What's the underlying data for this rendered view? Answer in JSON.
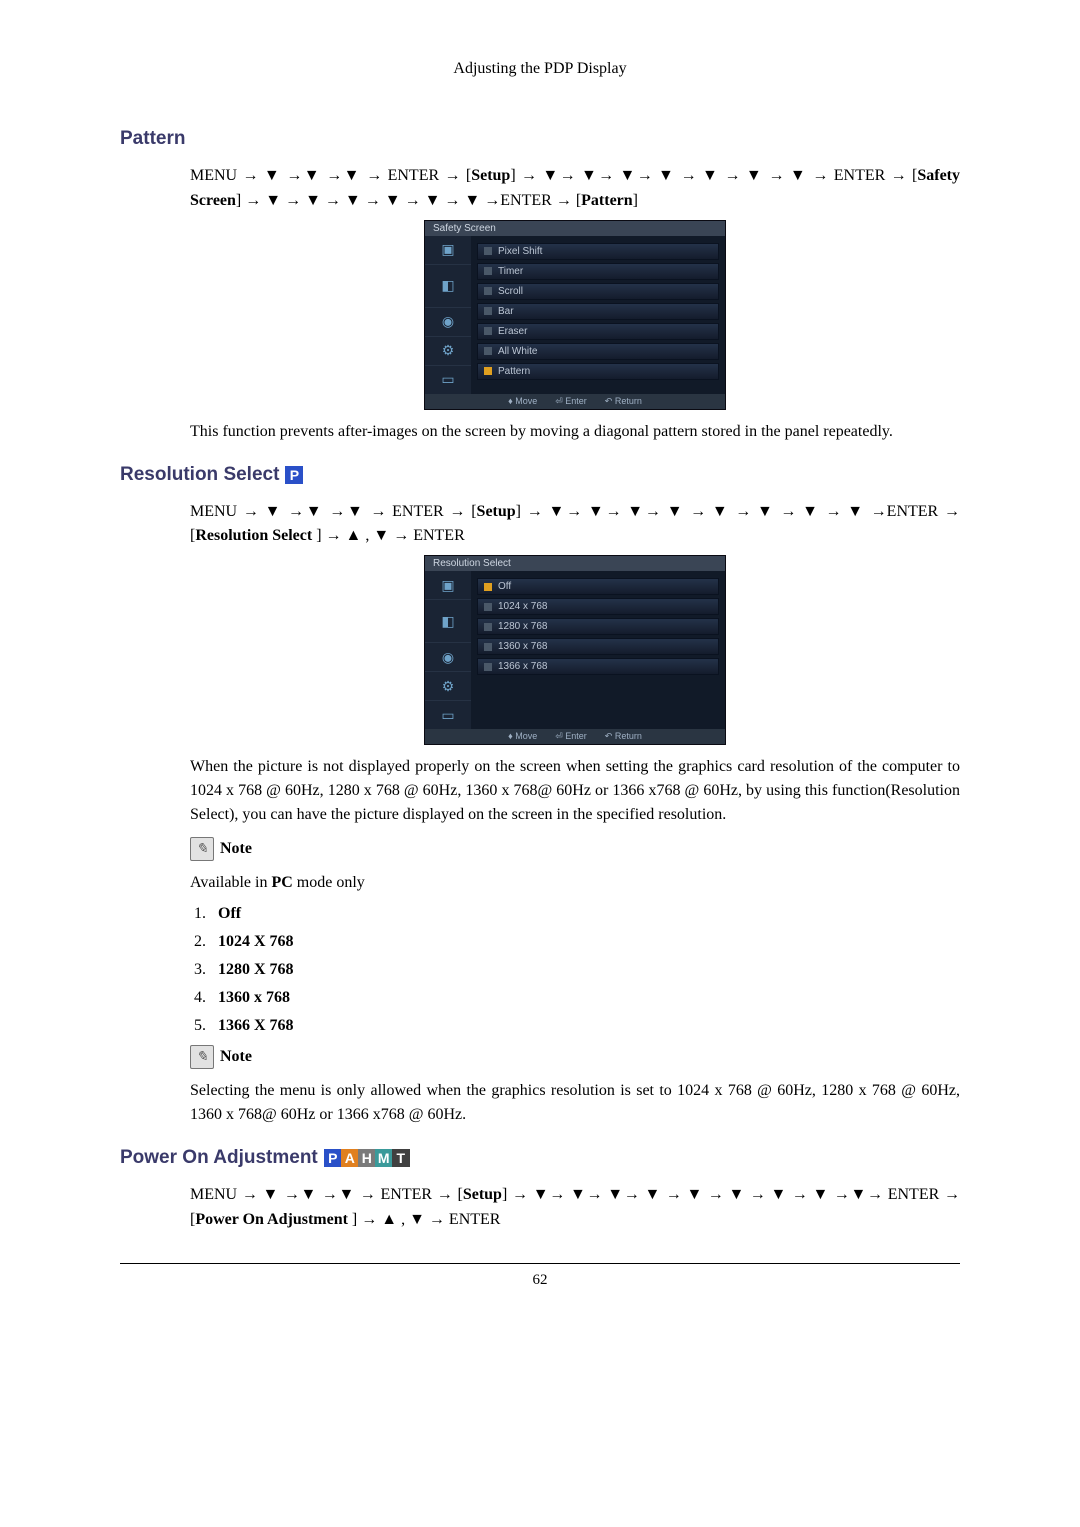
{
  "header": "Adjusting the PDP Display",
  "page_number": "62",
  "sections": {
    "pattern": {
      "title": "Pattern",
      "nav_path": "MENU → ▼ →▼ →▼ → ENTER → [Setup] → ▼→ ▼→ ▼→ ▼ → ▼ → ▼ → ▼ → ENTER → [Safety Screen] → ▼ → ▼ → ▼ → ▼ → ▼ → ▼ →ENTER → [Pattern]",
      "osd": {
        "title": "Safety Screen",
        "items": [
          "Pixel Shift",
          "Timer",
          "Scroll",
          "Bar",
          "Eraser",
          "All White",
          "Pattern"
        ],
        "active_index": 6,
        "footer": {
          "move": "Move",
          "enter": "Enter",
          "return": "Return"
        }
      },
      "description": "This function prevents after-images on the screen by moving a diagonal pattern stored in the panel repeatedly."
    },
    "resolution": {
      "title": "Resolution Select",
      "badges_p": "P",
      "nav_path": "MENU → ▼ →▼ →▼ → ENTER → [Setup] → ▼→ ▼→ ▼→ ▼ → ▼ → ▼ → ▼ → ▼ →ENTER → [Resolution Select ] → ▲ , ▼ → ENTER",
      "osd": {
        "title": "Resolution Select",
        "items": [
          "Off",
          "1024 x 768",
          "1280 x 768",
          "1360 x 768",
          "1366 x 768"
        ],
        "active_index": 0,
        "footer": {
          "move": "Move",
          "enter": "Enter",
          "return": "Return"
        }
      },
      "description": "When the picture is not displayed properly on the screen when setting the graphics card resolution of the computer to 1024 x 768 @ 60Hz, 1280 x 768 @ 60Hz, 1360 x 768@ 60Hz or 1366 x768 @ 60Hz, by using this function(Resolution Select), you can have the picture displayed on the screen in the specified resolution.",
      "note1_label": "Note",
      "note1_text_pre": "Available in ",
      "note1_text_bold": "PC",
      "note1_text_post": " mode only",
      "options": [
        "Off",
        "1024 X 768",
        "1280 X 768",
        "1360 x 768",
        "1366 X 768"
      ],
      "note2_label": "Note",
      "note2_text": "Selecting the menu is only allowed when the graphics resolution is set to 1024 x 768 @ 60Hz, 1280 x 768 @ 60Hz, 1360 x 768@ 60Hz or 1366 x768 @ 60Hz."
    },
    "power_on": {
      "title": "Power On Adjustment",
      "badges": {
        "p": "P",
        "a": "A",
        "h": "H",
        "m": "M",
        "t": "T"
      },
      "nav_path": "MENU → ▼ →▼ →▼ → ENTER → [Setup] → ▼→ ▼→ ▼→ ▼ → ▼ → ▼ → ▼ → ▼ →▼→ ENTER → [Power On Adjustment ] → ▲ , ▼ → ENTER"
    }
  }
}
